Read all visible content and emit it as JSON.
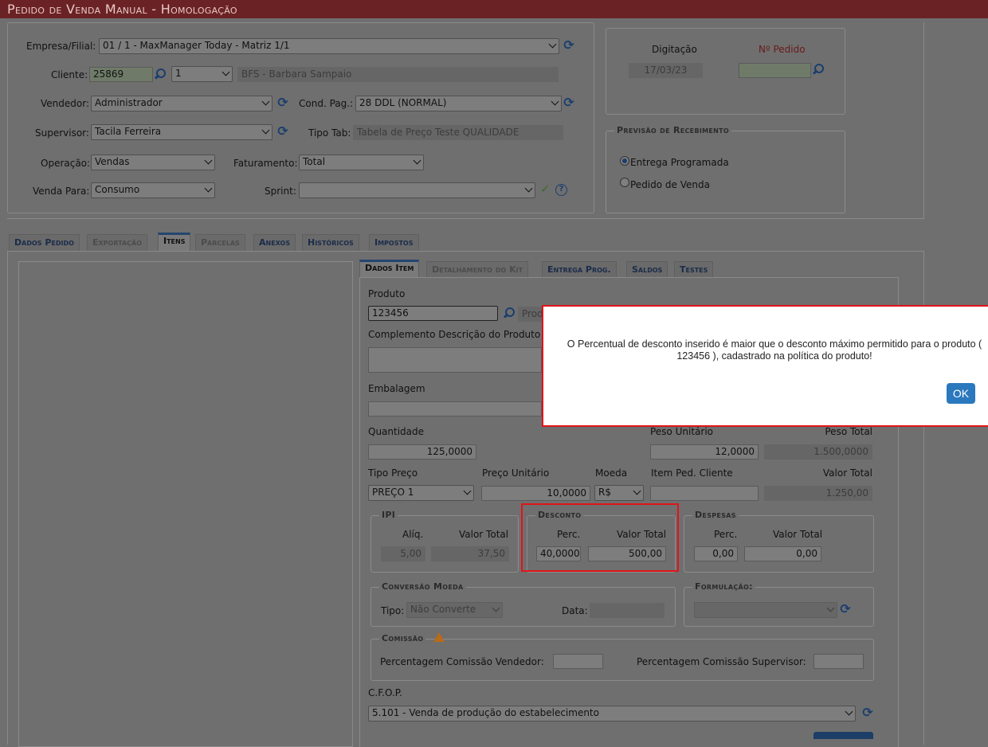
{
  "header": {
    "title": "Pedido de Venda Manual   - Homologação"
  },
  "form": {
    "empresa_label": "Empresa/Filial:",
    "empresa_value": "01 / 1 - MaxManager Today - Matriz 1/1",
    "cliente_label": "Cliente:",
    "cliente_code": "25869",
    "cliente_seq": "1",
    "cliente_name": "BFS - Barbara Sampaio",
    "vendedor_label": "Vendedor:",
    "vendedor_value": "Administrador",
    "condpag_label": "Cond. Pag.:",
    "condpag_value": "28 DDL (NORMAL)",
    "supervisor_label": "Supervisor:",
    "supervisor_value": "Tacila Ferreira",
    "tipotab_label": "Tipo Tab:",
    "tipotab_value": "Tabela de Preço Teste QUALIDADE",
    "operacao_label": "Operação:",
    "operacao_value": "Vendas",
    "faturamento_label": "Faturamento:",
    "faturamento_value": "Total",
    "vendapara_label": "Venda Para:",
    "vendapara_value": "Consumo",
    "sprint_label": "Sprint:",
    "sprint_value": "",
    "help_glyph": "?"
  },
  "right_panel": {
    "digitacao_label": "Digitação",
    "digitacao_value": "17/03/23",
    "npedido_label": "Nº Pedido",
    "npedido_value": "",
    "previsao_legend": "Previsão de Recebimento",
    "radio_entrega": "Entrega Programada",
    "radio_pedido": "Pedido de Venda"
  },
  "main_tabs": [
    "Dados Pedido",
    "Exportação",
    "Itens",
    "Parcelas",
    "Anexos",
    "Históricos",
    "Impostos"
  ],
  "sub_tabs": [
    "Dados Item",
    "Detalhamento do Kit",
    "Entrega Prog.",
    "Saldos",
    "Testes"
  ],
  "item": {
    "produto_label": "Produto",
    "produto_code": "123456",
    "produto_desc": "Prod",
    "complemento_label": "Complemento Descrição do Produto",
    "embalagem_label": "Embalagem",
    "quantidade_label": "Quantidade",
    "quantidade_value": "125,0000",
    "peso_unit_label": "Peso Unitário",
    "peso_unit_value": "12,0000",
    "peso_total_label": "Peso Total",
    "peso_total_value": "1.500,0000",
    "tipo_preco_label": "Tipo Preço",
    "tipo_preco_value": "PREÇO 1",
    "preco_unit_label": "Preço Unitário",
    "preco_unit_value": "10,0000",
    "moeda_label": "Moeda",
    "moeda_value": "R$",
    "item_ped_label": "Item Ped. Cliente",
    "valor_total_label": "Valor Total",
    "valor_total_value": "1.250,00",
    "ipi_legend": "IPI",
    "ipi_aliq_label": "Alíq.",
    "ipi_valor_label": "Valor Total",
    "ipi_aliq_value": "5,00",
    "ipi_valor_value": "37,50",
    "desconto_legend": "Desconto",
    "desc_perc_label": "Perc.",
    "desc_valor_label": "Valor Total",
    "desc_perc_value": "40,0000",
    "desc_valor_value": "500,00",
    "despesas_legend": "Despesas",
    "desp_perc_label": "Perc.",
    "desp_valor_label": "Valor Total",
    "desp_perc_value": "0,00",
    "desp_valor_value": "0,00",
    "conversao_legend": "Conversão Moeda",
    "tipo_label": "Tipo:",
    "tipo_value": "Não Converte",
    "data_label": "Data:",
    "formulacao_legend": "Formulação:",
    "comissao_legend": "Comissão",
    "com_vend_label": "Percentagem Comissão Vendedor:",
    "com_sup_label": "Percentagem Comissão Supervisor:",
    "cfop_label": "C.F.O.P.",
    "cfop_value": "5.101 - Venda de produção do estabelecimento"
  },
  "modal": {
    "message": "O Percentual de desconto inserido é maior que o desconto máximo permitido para o produto ( 123456 ), cadastrado na política do produto!",
    "ok_label": "OK"
  },
  "colors": {
    "titlebar": "#6b2224",
    "highlight": "#e0141a",
    "ok_button": "#2a78bd",
    "overlay": "#6f6f6f"
  }
}
